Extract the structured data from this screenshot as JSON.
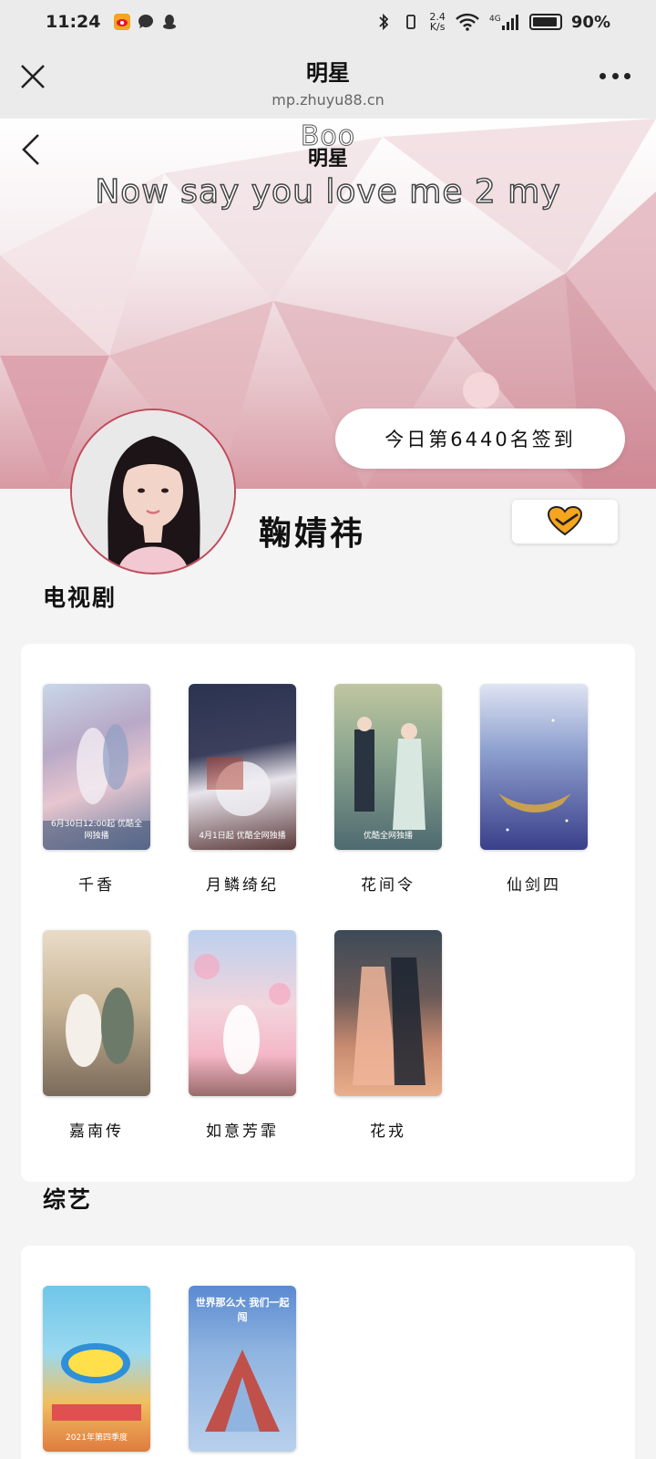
{
  "status_bar": {
    "time": "11:24",
    "net_speed_value": "2.4",
    "net_speed_unit": "K/s",
    "network": "4G",
    "battery": "90%"
  },
  "nav": {
    "title": "明星",
    "url": "mp.zhuyu88.cn"
  },
  "banner": {
    "overlay_word": "Boo",
    "page_name": "明星",
    "lyric": "Now say you love me 2 my",
    "checkin": "今日第6440名签到"
  },
  "profile": {
    "name": "鞠婧祎"
  },
  "tv_section": {
    "title": "电视剧",
    "items": [
      {
        "label": "千香",
        "poster_text": "6月30日12:00起 优酷全网独播"
      },
      {
        "label": "月鳞绮纪",
        "poster_text": "4月1日起 优酷全网独播"
      },
      {
        "label": "花间令",
        "poster_text": "优酷全网独播"
      },
      {
        "label": "仙剑四",
        "poster_text": ""
      },
      {
        "label": "嘉南传",
        "poster_text": ""
      },
      {
        "label": "如意芳霏",
        "poster_text": ""
      },
      {
        "label": "花戎",
        "poster_text": ""
      }
    ]
  },
  "variety_section": {
    "title": "综艺",
    "items": [
      {
        "label": "",
        "poster_text": "2021年第四季度"
      },
      {
        "label": "",
        "poster_text": "世界那么大 我们一起闯"
      }
    ]
  },
  "colors": {
    "banner_pink": "#d89aa4",
    "avatar_border": "#c24a5a",
    "heart_orange": "#f5a51e"
  }
}
